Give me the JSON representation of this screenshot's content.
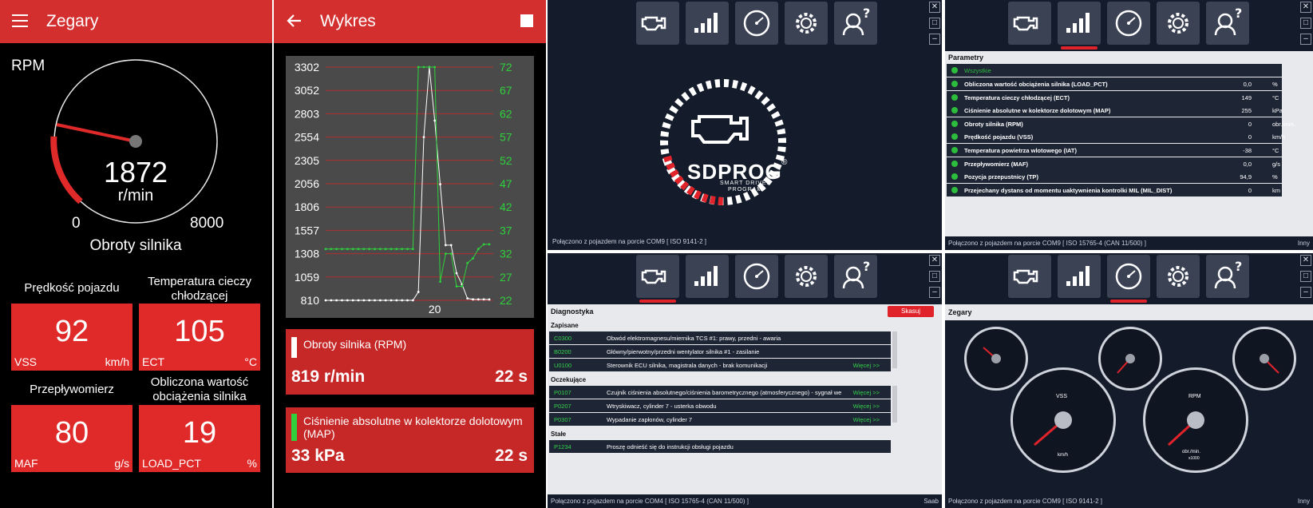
{
  "zegary": {
    "title": "Zegary",
    "rpm_label": "RPM",
    "rpm_value": "1872",
    "rpm_unit": "r/min",
    "scale_min": "0",
    "scale_max": "8000",
    "gauge_caption": "Obroty silnika",
    "rpm_fraction": 0.234,
    "tiles": [
      {
        "label": "Prędkość pojazdu",
        "value": "92",
        "code": "VSS",
        "unit": "km/h"
      },
      {
        "label": "Temperatura cieczy chłodzącej",
        "value": "105",
        "code": "ECT",
        "unit": "°C"
      },
      {
        "label": "Przepływomierz",
        "value": "80",
        "code": "MAF",
        "unit": "g/s"
      },
      {
        "label": "Obliczona wartość obciążenia silnika",
        "value": "19",
        "code": "LOAD_PCT",
        "unit": "%"
      }
    ]
  },
  "wykres": {
    "title": "Wykres",
    "y_left": [
      "3302",
      "3052",
      "2803",
      "2554",
      "2305",
      "2056",
      "1806",
      "1557",
      "1308",
      "1059",
      "810"
    ],
    "y_right": [
      "72",
      "67",
      "62",
      "57",
      "52",
      "47",
      "42",
      "37",
      "32",
      "27",
      "22"
    ],
    "x_tick": "20",
    "cards": [
      {
        "name": "Obroty silnika (RPM)",
        "value": "819 r/min",
        "time": "22 s",
        "color": "#ffffff"
      },
      {
        "name": "Ciśnienie absolutne w kolektorze dolotowym (MAP)",
        "value": "33 kPa",
        "time": "22 s",
        "color": "#2ed13c"
      }
    ]
  },
  "chart_data": {
    "type": "line",
    "title": "",
    "xlabel": "",
    "ylabel": "",
    "x": [
      0,
      1,
      2,
      3,
      4,
      5,
      6,
      7,
      8,
      9,
      10,
      11,
      12,
      13,
      14,
      15,
      16,
      17,
      18,
      19,
      20,
      21,
      22,
      23,
      24,
      25,
      26,
      27,
      28,
      29,
      30
    ],
    "ylim_left": [
      810,
      3302
    ],
    "ylim_right": [
      22,
      72
    ],
    "series": [
      {
        "name": "Obroty silnika (RPM)",
        "axis": "left",
        "color": "#ffffff",
        "values": [
          810,
          810,
          810,
          810,
          810,
          810,
          810,
          810,
          810,
          810,
          810,
          810,
          810,
          810,
          810,
          810,
          810,
          900,
          2554,
          3302,
          2730,
          2050,
          1400,
          1400,
          1100,
          980,
          830,
          820,
          820,
          820,
          819
        ]
      },
      {
        "name": "Ciśnienie absolutne w kolektorze dolotowym (MAP)",
        "axis": "right",
        "color": "#2ed13c",
        "values": [
          33,
          33,
          33,
          33,
          33,
          33,
          33,
          33,
          33,
          33,
          33,
          33,
          33,
          33,
          33,
          33,
          33,
          72,
          72,
          72,
          72,
          26,
          32,
          32,
          25,
          25,
          30,
          31,
          33,
          34,
          34
        ]
      }
    ]
  },
  "sdprog": {
    "logo": "SDPROG",
    "registered": "®",
    "tagline1": "SMART DRIVER",
    "tagline2": "PROGRAM",
    "toolbar": [
      "engine-icon",
      "signal-bars-icon",
      "gauge-icon",
      "gear-icon",
      "help-person-icon"
    ],
    "status_tl": "Połączono z pojazdem na porcie COM9  [ ISO 9141-2 ]",
    "status_tr": "Połączono z pojazdem na porcie COM9  [ ISO 15765-4 (CAN 11/500) ]",
    "status_tr_right": "Inny",
    "status_bl": "Połączono z pojazdem na porcie COM4  [ ISO 15765-4 (CAN 11/500) ]",
    "status_bl_right": "Saab",
    "status_br": "Połączono z pojazdem na porcie COM9  [ ISO 9141-2 ]",
    "status_br_right": "Inny",
    "params_title": "Parametry",
    "params_all": "Wszystkie",
    "params": [
      {
        "name": "Obliczona wartość obciążenia silnika (LOAD_PCT)",
        "value": "0,0",
        "unit": "%"
      },
      {
        "name": "Temperatura cieczy chłodzącej (ECT)",
        "value": "149",
        "unit": "°C"
      },
      {
        "name": "Ciśnienie absolutne w kolektorze dolotowym (MAP)",
        "value": "255",
        "unit": "kPa"
      },
      {
        "name": "Obroty silnika (RPM)",
        "value": "0",
        "unit": "obr./min."
      },
      {
        "name": "Prędkość pojazdu (VSS)",
        "value": "0",
        "unit": "km/h"
      },
      {
        "name": "Temperatura powietrza wlotowego (IAT)",
        "value": "-38",
        "unit": "°C"
      },
      {
        "name": "Przepływomierz (MAF)",
        "value": "0,0",
        "unit": "g/s"
      },
      {
        "name": "Pozycja przepustnicy (TP)",
        "value": "94,9",
        "unit": "%"
      },
      {
        "name": "Przejechany dystans od momentu uaktywnienia kontrolki MIL (MIL_DIST)",
        "value": "0",
        "unit": "km"
      }
    ],
    "diag_title": "Diagnostyka",
    "clear_btn": "Skasuj",
    "sec_saved": "Zapisane",
    "sec_pending": "Oczekujące",
    "sec_perm": "Stałe",
    "saved": [
      {
        "code": "C0300",
        "desc": "Obwód elektromagnesu/miernika TCS #1: prawy, przedni - awaria",
        "more": ""
      },
      {
        "code": "B0200",
        "desc": "Główny/pierwotny/przedni wentylator silnika #1 - zasilanie",
        "more": ""
      },
      {
        "code": "U0100",
        "desc": "Sterownik ECU silnika, magistrala danych - brak komunikacji",
        "more": "Więcej >>"
      }
    ],
    "pending": [
      {
        "code": "P0107",
        "desc": "Czujnik ciśnienia absolutnego/ciśnienia barometrycznego (atmosferycznego) - sygnał we",
        "more": "Więcej >>"
      },
      {
        "code": "P0207",
        "desc": "Wtryskiwacz, cylinder 7 - usterka obwodu",
        "more": "Więcej >>"
      },
      {
        "code": "P0307",
        "desc": "Wypadanie zapłonów, cylinder 7",
        "more": "Więcej >>"
      }
    ],
    "perm": [
      {
        "code": "P1234",
        "desc": "Proszę odnieść się do instrukcji obsługi pojazdu",
        "more": ""
      }
    ],
    "gauges_title": "Zegary",
    "vss_label": "VSS",
    "vss_unit": "km/h",
    "rpm_label": "RPM",
    "rpm_unit": "obr./min.",
    "rpm_mult": "x1000"
  }
}
